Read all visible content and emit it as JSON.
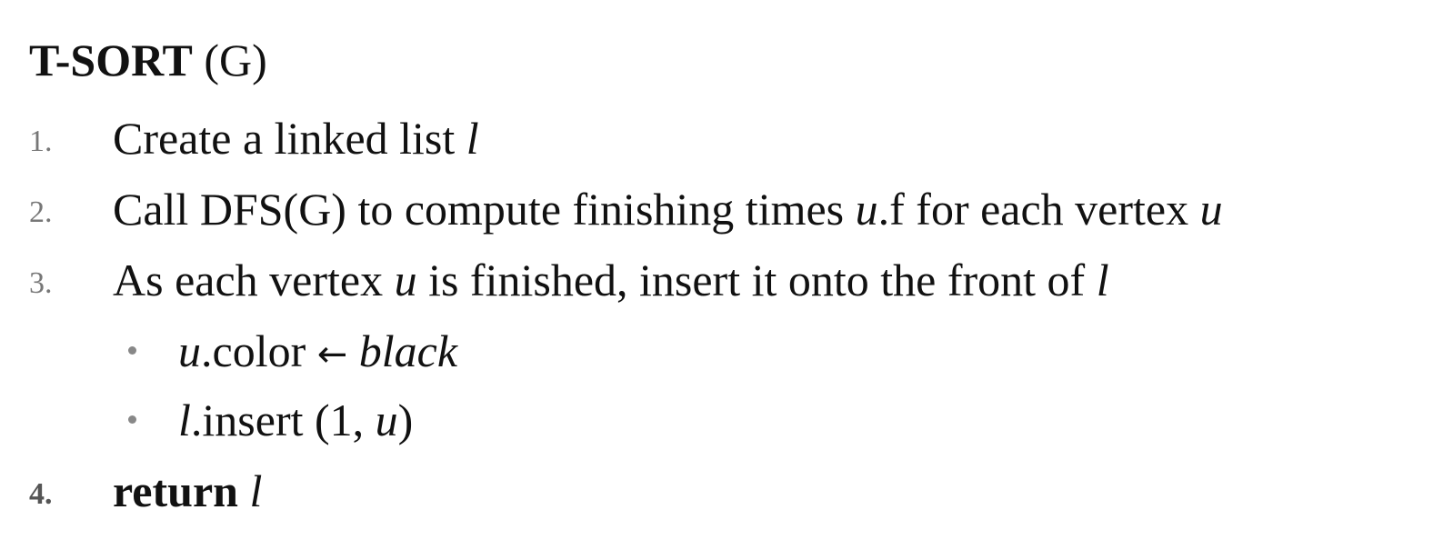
{
  "title": {
    "name": "T-SORT",
    "arg": "(G)"
  },
  "steps": [
    {
      "number": "1.",
      "text": "Create a linked list ",
      "var": "l"
    },
    {
      "number": "2.",
      "text_a": "Call DFS(G) to compute finishing times ",
      "var_a": "u",
      "text_b": ".f for each vertex ",
      "var_b": "u"
    },
    {
      "number": "3.",
      "text_a": "As each vertex ",
      "var_a": "u",
      "text_b": " is finished, insert it onto the front of ",
      "var_b": "l"
    },
    {
      "number": "4.",
      "keyword": "return",
      "var": "l"
    }
  ],
  "substeps": [
    {
      "var": "u",
      "text": ".color ",
      "arrow": "←",
      "value": "black"
    },
    {
      "var": "l",
      "text": ".insert (1, ",
      "arg": "u",
      "close": ")"
    }
  ]
}
